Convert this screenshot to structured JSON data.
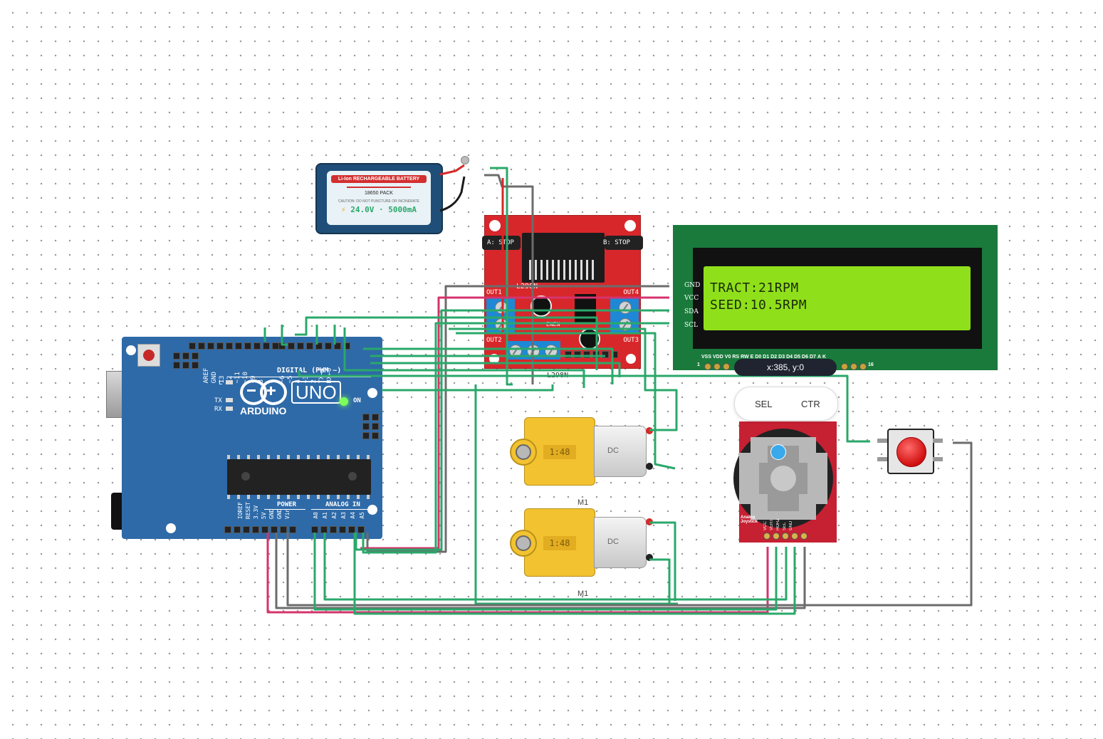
{
  "battery": {
    "title": "Li-Ion RECHARGEABLE BATTERY",
    "pack": "18650 PACK",
    "caution": "CAUTION: DO NOT PUNCTURE OR INCINERATE",
    "rating": "24.0V · 5000mA"
  },
  "driver": {
    "a_label": "A: STOP",
    "b_label": "B: STOP",
    "chip": "L298N",
    "out1": "OUT1",
    "out2": "OUT2",
    "out3": "OUT3",
    "out4": "OUT4",
    "enable_label": "ENEN",
    "bottom_label": "L298N"
  },
  "lcd": {
    "line1": "TRACT:21RPM",
    "line2": "SEED:10.5RPM",
    "i2c_pins": [
      "GND",
      "VCC",
      "SDA",
      "SCL"
    ],
    "bottom_pins": [
      "VSS",
      "VDD",
      "V0",
      "RS",
      "RW",
      "E",
      "D0",
      "D1",
      "D2",
      "D3",
      "D4",
      "D5",
      "D6",
      "D7",
      "A",
      "K"
    ],
    "pin_first": "1",
    "pin_last": "16",
    "tooltip": "x:385, y:0"
  },
  "joystick": {
    "sel_button": "SEL",
    "ctr_button": "CTR",
    "label": "Analog Joystick",
    "pins": [
      "VCC",
      "VERT",
      "HORZ",
      "SEL",
      "GND"
    ]
  },
  "arduino": {
    "brand": "ARDUINO",
    "model": "UNO",
    "on": "ON",
    "led_l": "L",
    "led_tx": "TX",
    "led_rx": "RX",
    "digital": "DIGITAL (PWM ~)",
    "digital_pins": [
      "AREF",
      "GND",
      "13",
      "12",
      "~11",
      "~10",
      "~9",
      "8",
      "7",
      "~6",
      "~5",
      "4",
      "~3",
      "2",
      "TX→1",
      "RX←0"
    ],
    "power": "POWER",
    "analog": "ANALOG IN",
    "power_pins": [
      "IOREF",
      "RESET",
      "3.3V",
      "5V",
      "GND",
      "GND",
      "Vin"
    ],
    "analog_pins": [
      "A0",
      "A1",
      "A2",
      "A3",
      "A4",
      "A5"
    ]
  },
  "motors": [
    {
      "ratio": "1:48",
      "type": "DC",
      "label": "M1"
    },
    {
      "ratio": "1:48",
      "type": "DC",
      "label": "M1"
    }
  ],
  "colors": {
    "wire_green": "#2aa86a",
    "wire_gray": "#6c6c6c",
    "wire_pink": "#d6336c",
    "wire_black": "#1a1a1a",
    "wire_red": "#d62828",
    "board_blue": "#2e6aa8",
    "driver_red": "#d8272b",
    "lcd_green": "#1a7a3c",
    "lcd_screen": "#8fe01a"
  }
}
